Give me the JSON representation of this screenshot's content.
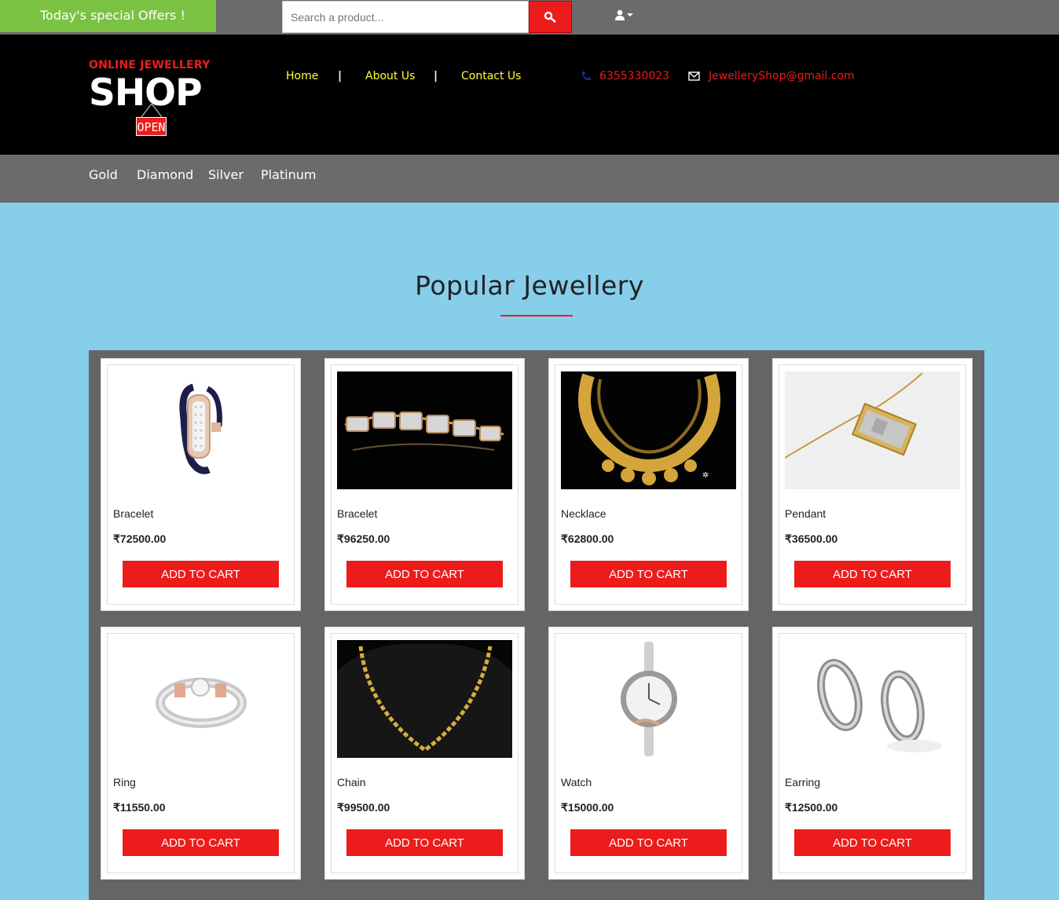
{
  "topbar": {
    "offers": "Today's special Offers !",
    "search_placeholder": "Search a product...",
    "search_icon": "search-icon",
    "user_icon": "user-icon"
  },
  "header": {
    "logo_top": "ONLINE JEWELLERY",
    "logo_main": "SHOP",
    "logo_sign": "OPEN",
    "nav": [
      "Home",
      "About Us",
      "Contact Us"
    ],
    "phone": "6355330023",
    "email": "JewelleryShop@gmail.com"
  },
  "categories": [
    "Gold",
    "Diamond",
    "Silver",
    "Platinum"
  ],
  "section_title": "Popular Jewellery",
  "cart_label": "ADD TO CART",
  "colors": {
    "accent": "#ed1c1c",
    "offers": "#7cc242",
    "nav_text": "#ffff33",
    "bg": "#87ceeb",
    "bar": "#6b6b6b"
  },
  "products": [
    {
      "name": "Bracelet",
      "price": "₹72500.00",
      "image": "bracelet-image"
    },
    {
      "name": "Bracelet",
      "price": "₹96250.00",
      "image": "bracelet-image"
    },
    {
      "name": "Necklace",
      "price": "₹62800.00",
      "image": "necklace-image"
    },
    {
      "name": "Pendant",
      "price": "₹36500.00",
      "image": "pendant-image"
    },
    {
      "name": "Ring",
      "price": "₹11550.00",
      "image": "ring-image"
    },
    {
      "name": "Chain",
      "price": "₹99500.00",
      "image": "chain-image"
    },
    {
      "name": "Watch",
      "price": "₹15000.00",
      "image": "watch-image"
    },
    {
      "name": "Earring",
      "price": "₹12500.00",
      "image": "earring-image"
    }
  ]
}
